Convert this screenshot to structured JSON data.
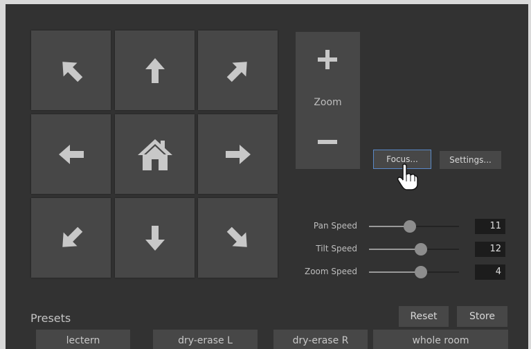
{
  "ptz_pad": {
    "buttons": [
      {
        "icon": "arrow-up-left-icon"
      },
      {
        "icon": "arrow-up-icon"
      },
      {
        "icon": "arrow-up-right-icon"
      },
      {
        "icon": "arrow-left-icon"
      },
      {
        "icon": "home-icon"
      },
      {
        "icon": "arrow-right-icon"
      },
      {
        "icon": "arrow-down-left-icon"
      },
      {
        "icon": "arrow-down-icon"
      },
      {
        "icon": "arrow-down-right-icon"
      }
    ]
  },
  "zoom": {
    "label": "Zoom",
    "plus_icon": "plus-icon",
    "minus_icon": "minus-icon"
  },
  "buttons": {
    "focus": "Focus...",
    "settings": "Settings..."
  },
  "speeds": [
    {
      "label": "Pan Speed",
      "value": "11",
      "fraction": 0.45
    },
    {
      "label": "Tilt Speed",
      "value": "12",
      "fraction": 0.58
    },
    {
      "label": "Zoom Speed",
      "value": "4",
      "fraction": 0.58
    }
  ],
  "presets": {
    "title": "Presets",
    "reset": "Reset",
    "store": "Store",
    "items": [
      "lectern",
      "dry-erase L",
      "dry-erase R",
      "whole room"
    ]
  },
  "colors": {
    "panel": "#323232",
    "button": "#474747",
    "icon": "#c8c8c8",
    "focus_border": "#5b8ac9"
  }
}
